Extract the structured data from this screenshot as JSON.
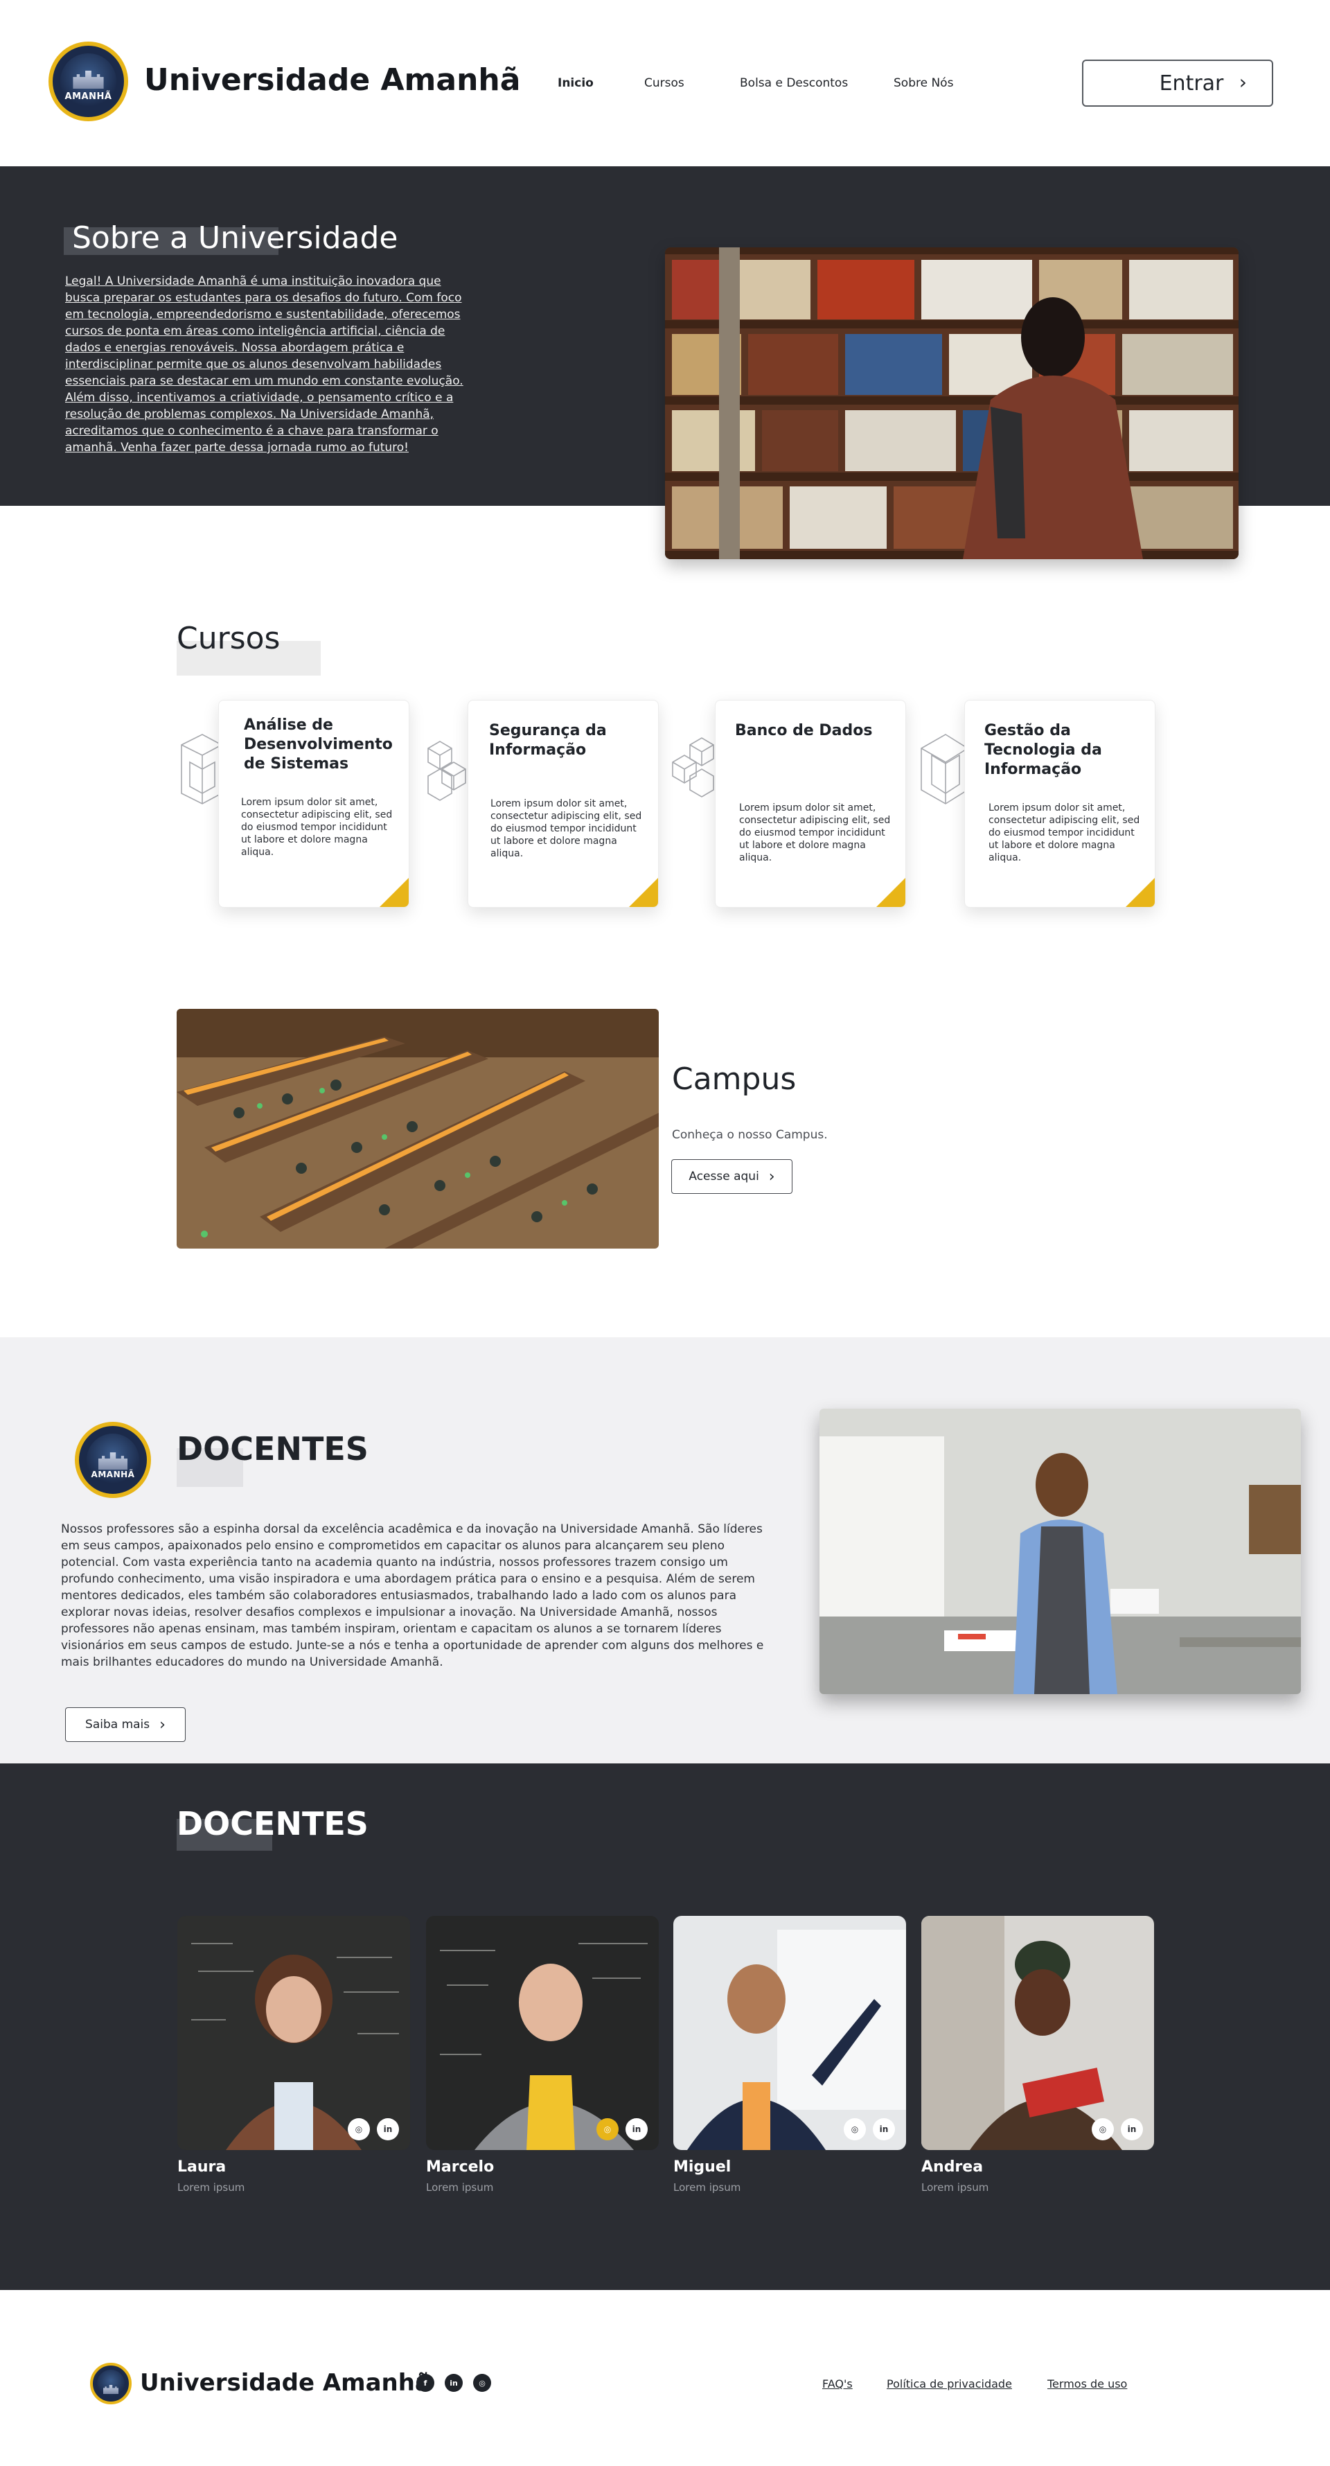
{
  "header": {
    "logo_text": "AMANHÃ",
    "brand": "Universidade Amanhã",
    "nav": [
      "Inicio",
      "Cursos",
      "Bolsa e Descontos",
      "Sobre Nós"
    ],
    "login_label": "Entrar"
  },
  "about": {
    "title": "Sobre a Universidade",
    "text": "Legal! A Universidade Amanhã é uma instituição inovadora que busca preparar os estudantes para os desafios do futuro. Com foco em tecnologia, empreendedorismo e sustentabilidade, oferecemos cursos de ponta em áreas como inteligência artificial, ciência de dados e energias renováveis. Nossa abordagem prática e interdisciplinar permite que os alunos desenvolvam habilidades essenciais para se destacar em um mundo em constante evolução. Além disso, incentivamos a criatividade, o pensamento crítico e a resolução de problemas complexos. Na Universidade Amanhã, acreditamos que o conhecimento é a chave para transformar o amanhã. Venha fazer parte dessa jornada rumo ao futuro!",
    "image": "library-bookshelf-photo"
  },
  "courses": {
    "title": "Cursos",
    "items": [
      {
        "title": "Análise de Desenvolvimento de Sistemas",
        "text": "Lorem ipsum dolor sit amet, consectetur adipiscing elit, sed do eiusmod tempor incididunt ut labore et dolore magna aliqua."
      },
      {
        "title": "Segurança da Informação",
        "text": "Lorem ipsum dolor sit amet, consectetur adipiscing elit, sed do eiusmod tempor incididunt ut labore et dolore magna aliqua."
      },
      {
        "title": "Banco de Dados",
        "text": "Lorem ipsum dolor sit amet, consectetur adipiscing elit, sed do eiusmod tempor incididunt ut labore et dolore magna aliqua."
      },
      {
        "title": "Gestão da Tecnologia da Informação",
        "text": "Lorem ipsum dolor sit amet, consectetur adipiscing elit, sed do eiusmod tempor incididunt ut labore et dolore magna aliqua."
      }
    ]
  },
  "campus": {
    "title": "Campus",
    "subtitle": "Conheça o nosso Campus.",
    "button": "Acesse aqui",
    "image": "library-reading-room-photo"
  },
  "docentes_intro": {
    "title": "DOCENTES",
    "text": "Nossos professores são a espinha dorsal da excelência acadêmica e da inovação na Universidade Amanhã. São líderes em seus campos, apaixonados pelo ensino e comprometidos em capacitar os alunos para alcançarem seu pleno potencial. Com vasta experiência tanto na academia quanto na indústria, nossos professores trazem consigo um profundo conhecimento, uma visão inspiradora e uma abordagem prática para o ensino e a pesquisa. Além de serem mentores dedicados, eles também são colaboradores entusiasmados, trabalhando lado a lado com os alunos para explorar novas ideias, resolver desafios complexos e impulsionar a inovação. Na Universidade Amanhã, nossos professores não apenas ensinam, mas também inspiram, orientam e capacitam os alunos a se tornarem líderes visionários em seus campos de estudo. Junte-se a nós e tenha a oportunidade de aprender com alguns dos melhores e mais brilhantes educadores do mundo na Universidade Amanhã.",
    "button": "Saiba mais",
    "image": "teacher-classroom-photo"
  },
  "docentes_team": {
    "title": "DOCENTES",
    "members": [
      {
        "name": "Laura",
        "role": "Lorem ipsum"
      },
      {
        "name": "Marcelo",
        "role": "Lorem ipsum"
      },
      {
        "name": "Miguel",
        "role": "Lorem ipsum"
      },
      {
        "name": "Andrea",
        "role": "Lorem ipsum"
      }
    ]
  },
  "footer": {
    "brand": "Universidade Amanhã",
    "links": [
      "FAQ's",
      "Política de privacidade",
      "Termos de uso"
    ]
  },
  "colors": {
    "accent": "#e8b518",
    "dark": "#2b2d33",
    "light_section": "#f1f1f3"
  }
}
